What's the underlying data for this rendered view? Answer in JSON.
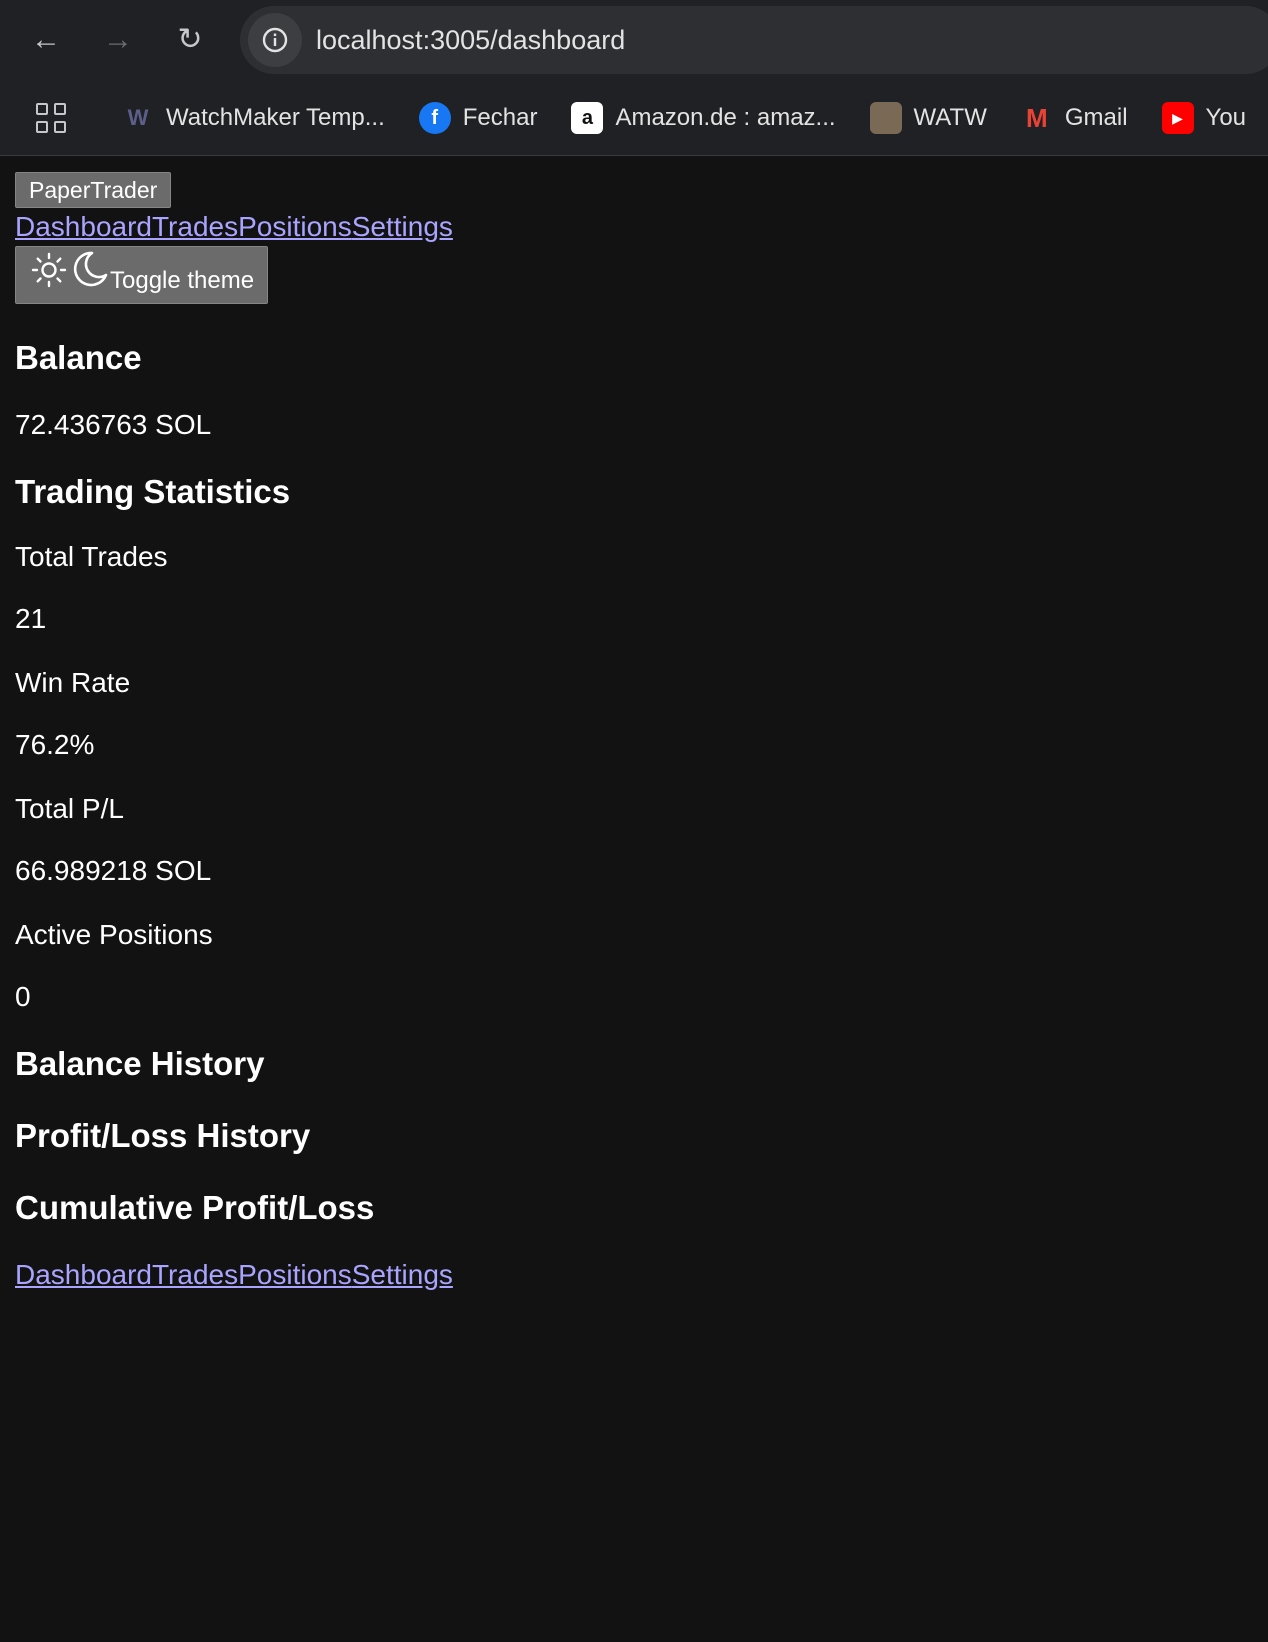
{
  "browser": {
    "url": "localhost:3005/dashboard",
    "bookmarks": [
      {
        "label": "WatchMaker Temp...",
        "icon": "watchmaker-icon"
      },
      {
        "label": "Fechar",
        "icon": "facebook-icon"
      },
      {
        "label": "Amazon.de : amaz...",
        "icon": "amazon-icon"
      },
      {
        "label": "WATW",
        "icon": "watw-icon"
      },
      {
        "label": "Gmail",
        "icon": "gmail-icon"
      },
      {
        "label": "You",
        "icon": "youtube-icon"
      }
    ]
  },
  "header": {
    "brand": "PaperTrader",
    "nav": [
      "Dashboard",
      "Trades",
      "Positions",
      "Settings"
    ],
    "theme_toggle_label": "Toggle theme"
  },
  "balance": {
    "title": "Balance",
    "value": "72.436763 SOL"
  },
  "stats": {
    "title": "Trading Statistics",
    "items": [
      {
        "label": "Total Trades",
        "value": "21"
      },
      {
        "label": "Win Rate",
        "value": "76.2%"
      },
      {
        "label": "Total P/L",
        "value": "66.989218 SOL"
      },
      {
        "label": "Active Positions",
        "value": "0"
      }
    ]
  },
  "sections": {
    "balance_history": "Balance History",
    "pl_history": "Profit/Loss History",
    "cumulative_pl": "Cumulative Profit/Loss"
  },
  "footer": {
    "nav": [
      "Dashboard",
      "Trades",
      "Positions",
      "Settings"
    ]
  },
  "colors": {
    "background": "#121212",
    "link": "#a8a4ff",
    "button": "#6b6b6b"
  }
}
